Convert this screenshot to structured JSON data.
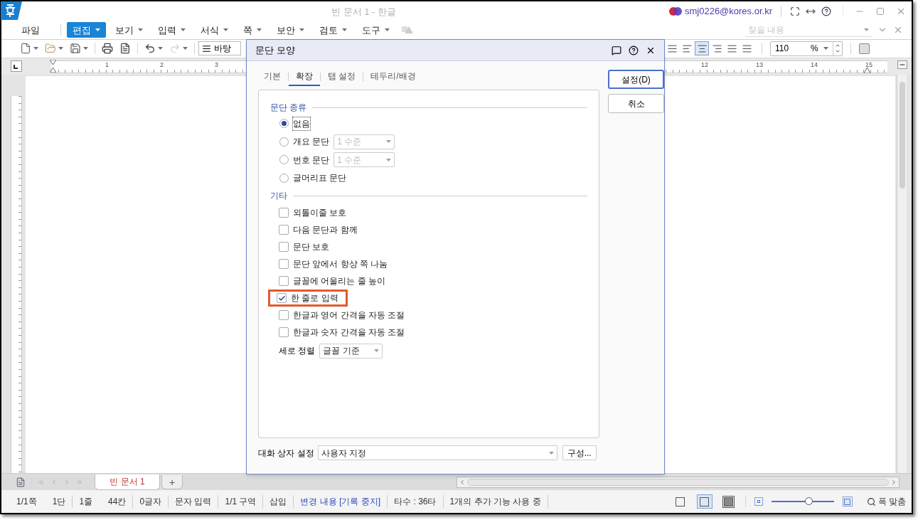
{
  "window": {
    "title": "빈 문서 1 - 한글",
    "user": "smj0226@kores.or.kr"
  },
  "menu": [
    {
      "label": "파일",
      "selected": false,
      "dropdown": false
    },
    {
      "label": "편집",
      "selected": true,
      "dropdown": true
    },
    {
      "label": "보기",
      "selected": false,
      "dropdown": true
    },
    {
      "label": "입력",
      "selected": false,
      "dropdown": true
    },
    {
      "label": "서식",
      "selected": false,
      "dropdown": true
    },
    {
      "label": "쪽",
      "selected": false,
      "dropdown": true
    },
    {
      "label": "보안",
      "selected": false,
      "dropdown": true
    },
    {
      "label": "검토",
      "selected": false,
      "dropdown": true
    },
    {
      "label": "도구",
      "selected": false,
      "dropdown": true
    }
  ],
  "find_field": {
    "placeholder": "찾을 내용"
  },
  "toolbar": {
    "style_box": "바탕",
    "alignment": [
      {
        "selected": false
      },
      {
        "selected": false
      },
      {
        "selected": true
      },
      {
        "selected": false
      },
      {
        "selected": false
      },
      {
        "selected": false
      }
    ],
    "zoom": {
      "value": "110",
      "unit": "%"
    }
  },
  "ruler": {
    "left_ticks": [
      "1",
      "2",
      "3"
    ],
    "right_ticks": [
      "12",
      "13",
      "14",
      "15"
    ]
  },
  "dialog": {
    "title": "문단 모양",
    "tabs": [
      {
        "label": "기본",
        "selected": false
      },
      {
        "label": "확장",
        "selected": true
      },
      {
        "label": "탭 설정",
        "selected": false
      },
      {
        "label": "테두리/배경",
        "selected": false
      }
    ],
    "buttons": [
      {
        "label": "설정(D)",
        "kind": "primary"
      },
      {
        "label": "취소",
        "kind": "normal"
      }
    ],
    "paragraph_type": {
      "heading": "문단 종류",
      "options": [
        {
          "label": "없음",
          "selected": true,
          "focused": true
        },
        {
          "label": "개요 문단",
          "selected": false,
          "focused": false,
          "level_select": {
            "value": "1 수준",
            "disabled": true
          }
        },
        {
          "label": "번호 문단",
          "selected": false,
          "focused": false,
          "level_select": {
            "value": "1 수준",
            "disabled": true
          }
        },
        {
          "label": "글머리표 문단",
          "selected": false,
          "focused": false
        }
      ]
    },
    "other": {
      "heading": "기타",
      "options": [
        {
          "label": "외톨이줄 보호",
          "checked": false,
          "highlighted": false
        },
        {
          "label": "다음 문단과 함께",
          "checked": false,
          "highlighted": false
        },
        {
          "label": "문단 보호",
          "checked": false,
          "highlighted": false
        },
        {
          "label": "문단 앞에서 항상 쪽 나눔",
          "checked": false,
          "highlighted": false
        },
        {
          "label": "글꼴에 어울리는 줄 높이",
          "checked": false,
          "highlighted": false
        },
        {
          "label": "한 줄로 입력",
          "checked": true,
          "highlighted": true
        },
        {
          "label": "한글과 영어 간격을 자동 조절",
          "checked": false,
          "highlighted": false
        },
        {
          "label": "한글과 숫자 간격을 자동 조절",
          "checked": false,
          "highlighted": false
        }
      ]
    },
    "vertical_align": {
      "label": "세로 정렬",
      "value": "글꼴 기준"
    },
    "dialog_setting": {
      "label": "대화 상자 설정",
      "value": "사용자 지정",
      "button": "구성..."
    }
  },
  "document_tabs": [
    {
      "label": "빈 문서 1",
      "selected": true
    }
  ],
  "add_tab": "+",
  "status_bar": {
    "groups": [
      {
        "items": [
          "1/1쪽",
          "1단"
        ],
        "kind": "plain"
      },
      {
        "items": [
          "1줄",
          "44칸"
        ],
        "kind": "plain"
      },
      {
        "items": [
          "0글자"
        ],
        "kind": "plain"
      },
      {
        "items": [
          "문자 입력"
        ],
        "kind": "plain"
      },
      {
        "items": [
          "1/1 구역"
        ],
        "kind": "plain"
      },
      {
        "items": [
          "삽입"
        ],
        "kind": "plain"
      },
      {
        "items": [
          "변경 내용 [기록 중지]"
        ],
        "kind": "link"
      },
      {
        "items": [
          "타수 : 36타"
        ],
        "kind": "plain"
      },
      {
        "items": [
          "1개의 추가 기능 사용 중"
        ],
        "kind": "plain"
      }
    ],
    "view_modes": [
      {
        "selected": false
      },
      {
        "selected": true
      },
      {
        "selected": false
      }
    ],
    "zoom_slider": {
      "level": 0.6
    },
    "fit_label": "폭 맞춤"
  }
}
